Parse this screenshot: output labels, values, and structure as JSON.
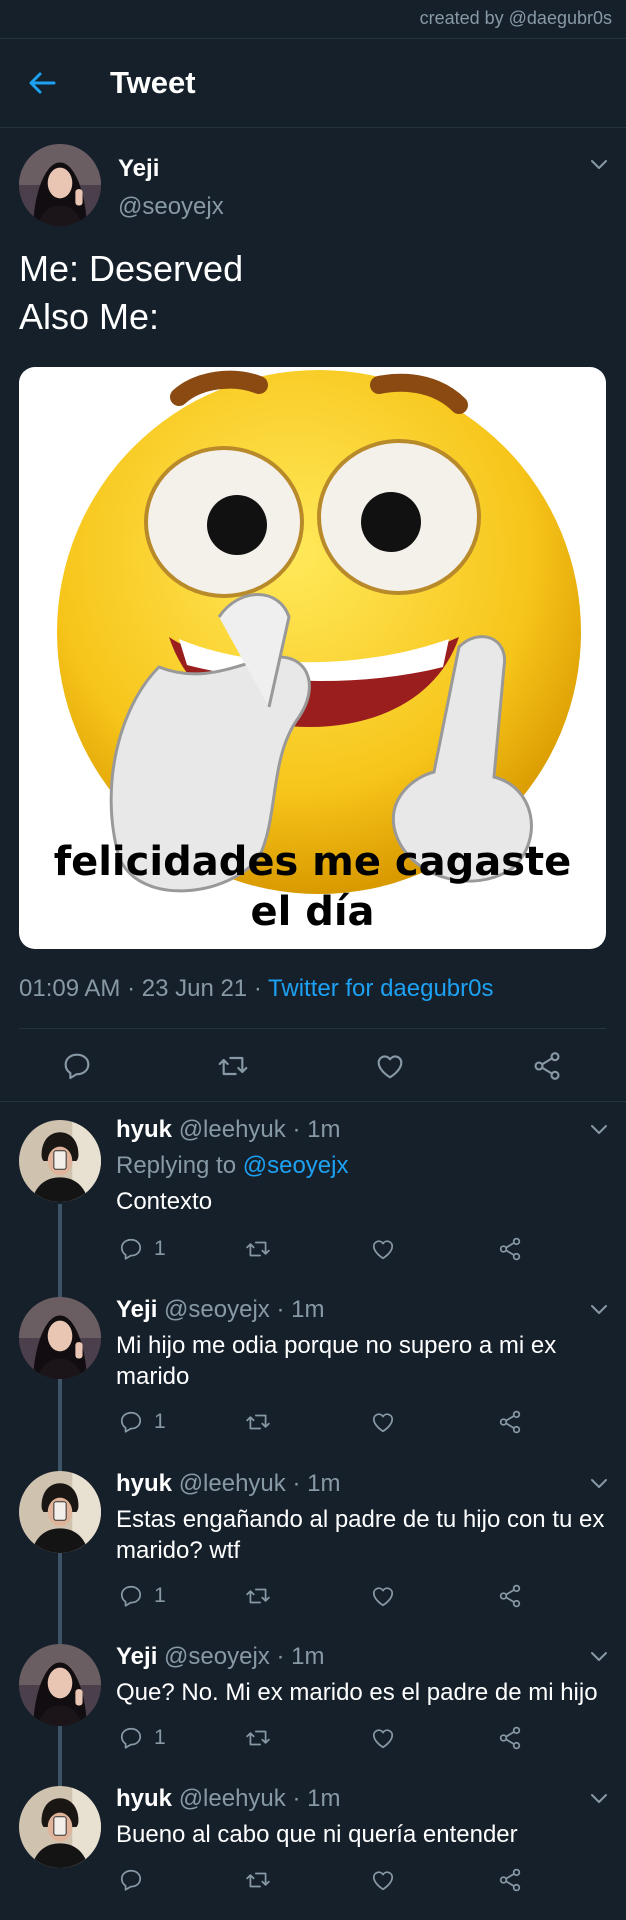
{
  "credit": "created by @daegubr0s",
  "header": {
    "title": "Tweet"
  },
  "main_tweet": {
    "name": "Yeji",
    "handle": "@seoyejx",
    "text": "Me: Deserved\nAlso Me:",
    "meme_caption": "felicidades me cagaste\nel día",
    "time": "01:09 AM · 23 Jun 21 · ",
    "source": "Twitter for daegubr0s"
  },
  "replies": [
    {
      "name": "hyuk",
      "handle": "@leehyuk",
      "time": "· 1m",
      "replying_label": "Replying to ",
      "replying_to": "@seoyejx",
      "text": "Contexto",
      "reply_count": "1"
    },
    {
      "name": "Yeji",
      "handle": "@seoyejx",
      "time": "· 1m",
      "text": "Mi hijo me odia porque no supero a mi ex marido",
      "reply_count": "1"
    },
    {
      "name": "hyuk",
      "handle": "@leehyuk",
      "time": "· 1m",
      "text": "Estas engañando al padre de tu hijo con tu ex marido? wtf",
      "reply_count": "1"
    },
    {
      "name": "Yeji",
      "handle": "@seoyejx",
      "time": "· 1m",
      "text": "Que? No. Mi ex marido es el padre de mi hijo",
      "reply_count": "1"
    },
    {
      "name": "hyuk",
      "handle": "@leehyuk",
      "time": "· 1m",
      "text": "Bueno al cabo que ni quería entender",
      "reply_count": ""
    }
  ],
  "colors": {
    "background": "#15202b",
    "accent": "#1da1f2",
    "muted": "#8899a6",
    "divider": "#253341"
  },
  "icons": [
    "back-arrow-icon",
    "chevron-down-icon",
    "reply-icon",
    "retweet-icon",
    "like-icon",
    "share-icon"
  ]
}
